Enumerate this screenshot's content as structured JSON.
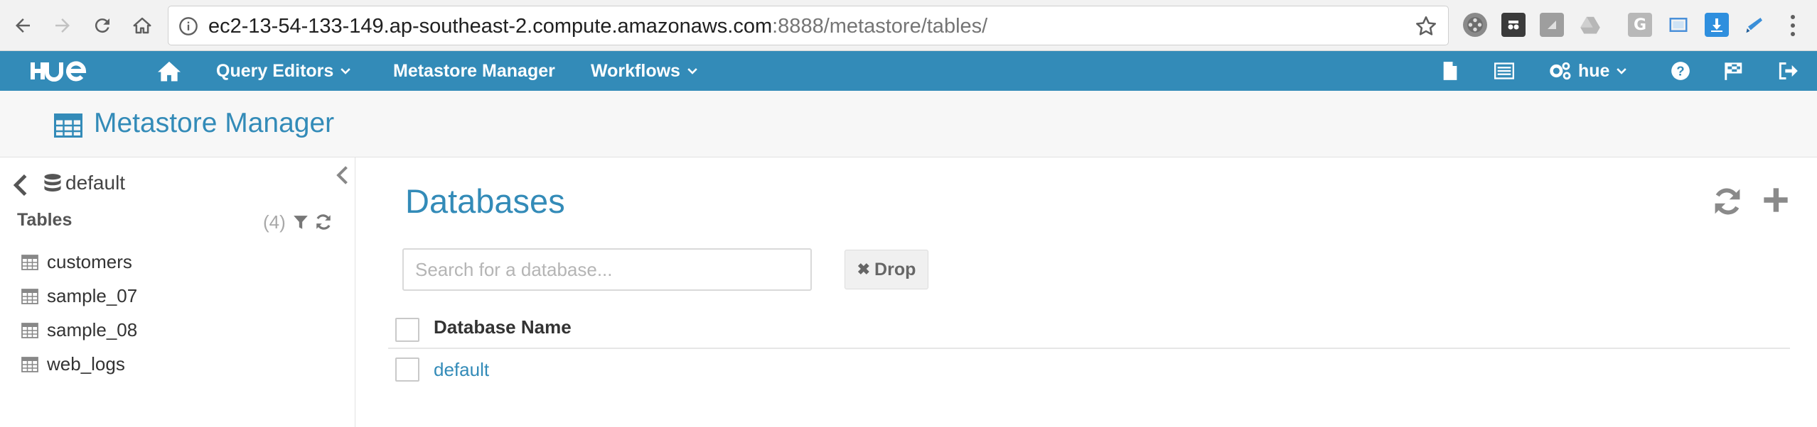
{
  "browser": {
    "url_host": "ec2-13-54-133-149.ap-southeast-2.compute.amazonaws.com",
    "url_rest": ":8888/metastore/tables/"
  },
  "hue_nav": {
    "logo": "HUE",
    "query_editors": "Query Editors",
    "metastore_manager": "Metastore Manager",
    "workflows": "Workflows",
    "user": "hue"
  },
  "page": {
    "title": "Metastore Manager"
  },
  "sidebar": {
    "database": "default",
    "tables_label": "Tables",
    "tables_count": "(4)",
    "tables": [
      {
        "name": "customers"
      },
      {
        "name": "sample_07"
      },
      {
        "name": "sample_08"
      },
      {
        "name": "web_logs"
      }
    ]
  },
  "main": {
    "title": "Databases",
    "search_placeholder": "Search for a database...",
    "drop_label": "Drop",
    "column_header": "Database Name",
    "databases": [
      {
        "name": "default"
      }
    ]
  },
  "colors": {
    "brand": "#338bb8",
    "header_bg": "#f7f7f7"
  }
}
